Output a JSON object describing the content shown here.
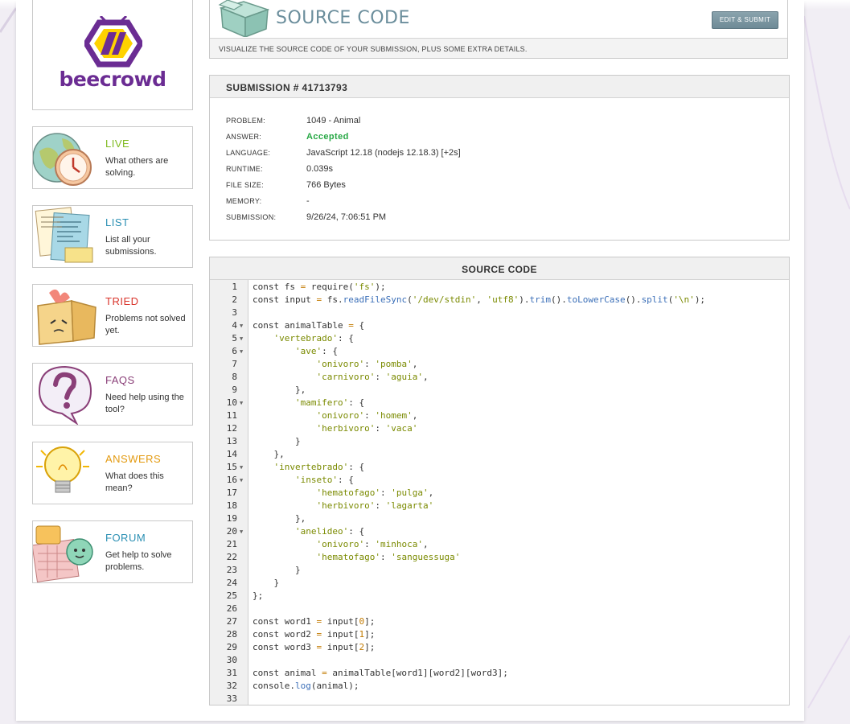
{
  "sidebar": {
    "logo_text": "beecrowd",
    "items": [
      {
        "title": "LIVE",
        "desc": "What others are solving.",
        "color": "#7fba1f",
        "icon": "globe-clock-icon"
      },
      {
        "title": "LIST",
        "desc": "List all your submissions.",
        "color": "#2a8fb3",
        "icon": "papers-icon"
      },
      {
        "title": "TRIED",
        "desc": "Problems not solved yet.",
        "color": "#d9342b",
        "icon": "box-icon"
      },
      {
        "title": "FAQS",
        "desc": "Need help using the tool?",
        "color": "#8a3f78",
        "icon": "question-bubble-icon"
      },
      {
        "title": "ANSWERS",
        "desc": "What does this mean?",
        "color": "#e39a10",
        "icon": "lightbulb-icon"
      },
      {
        "title": "FORUM",
        "desc": "Get help to solve problems.",
        "color": "#2a8fb3",
        "icon": "chat-icon"
      }
    ]
  },
  "header": {
    "title": "SOURCE CODE",
    "subtitle": "VISUALIZE THE SOURCE CODE OF YOUR SUBMISSION, PLUS SOME EXTRA DETAILS.",
    "edit_button": "EDIT & SUBMIT",
    "icon": "box-icon"
  },
  "submission": {
    "title": "SUBMISSION # 41713793",
    "fields": [
      {
        "label": "PROBLEM:",
        "value": "1049 - Animal"
      },
      {
        "label": "ANSWER:",
        "value": "Accepted"
      },
      {
        "label": "LANGUAGE:",
        "value": "JavaScript 12.18 (nodejs 12.18.3) [+2s]"
      },
      {
        "label": "RUNTIME:",
        "value": "0.039s"
      },
      {
        "label": "FILE SIZE:",
        "value": "766 Bytes"
      },
      {
        "label": "MEMORY:",
        "value": "-"
      },
      {
        "label": "SUBMISSION:",
        "value": "9/26/24, 7:06:51 PM"
      }
    ]
  },
  "code": {
    "title": "SOURCE CODE",
    "lines": [
      "const fs = require('fs');",
      "const input = fs.readFileSync('/dev/stdin', 'utf8').trim().toLowerCase().split('\\n');",
      "",
      "const animalTable = {",
      "    'vertebrado': {",
      "        'ave': {",
      "            'onivoro': 'pomba',",
      "            'carnivoro': 'aguia',",
      "        },",
      "        'mamifero': {",
      "            'onivoro': 'homem',",
      "            'herbivoro': 'vaca'",
      "        }",
      "    },",
      "    'invertebrado': {",
      "        'inseto': {",
      "            'hematofago': 'pulga',",
      "            'herbivoro': 'lagarta'",
      "        },",
      "        'anelideo': {",
      "            'onivoro': 'minhoca',",
      "            'hematofago': 'sanguessuga'",
      "        }",
      "    }",
      "};",
      "",
      "const word1 = input[0];",
      "const word2 = input[1];",
      "const word3 = input[2];",
      "",
      "const animal = animalTable[word1][word2][word3];",
      "console.log(animal);",
      ""
    ],
    "fold_lines": [
      4,
      5,
      6,
      10,
      15,
      16,
      20
    ]
  }
}
